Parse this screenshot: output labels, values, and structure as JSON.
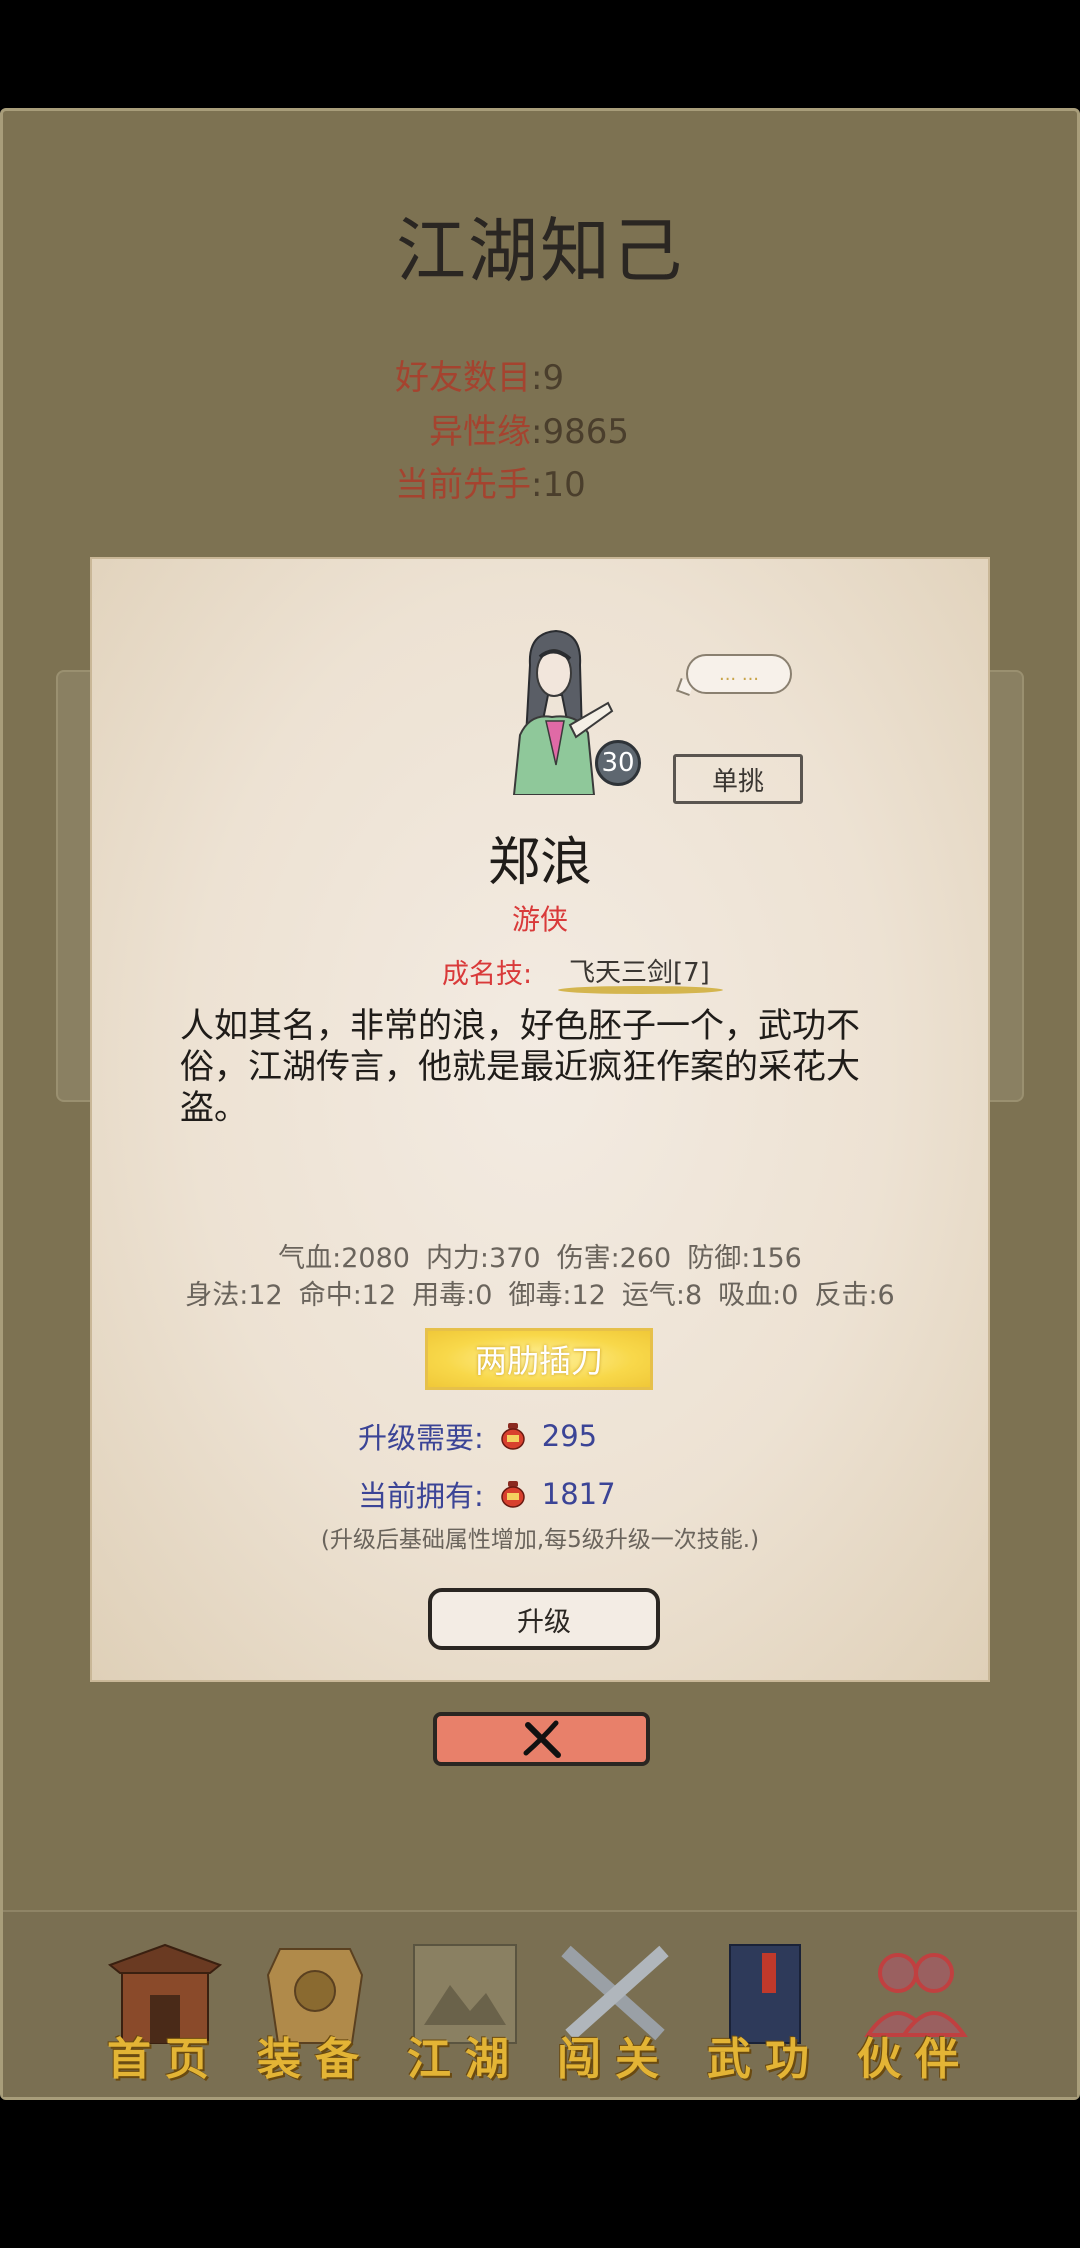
{
  "title": "江湖知己",
  "stats": {
    "friends": {
      "label": "好友数目",
      "value": "9"
    },
    "affinity": {
      "label": "异性缘",
      "value": "9865"
    },
    "initiative": {
      "label": "当前先手",
      "value": "10"
    }
  },
  "character": {
    "level": "30",
    "speech": "... ...",
    "duel_label": "单挑",
    "name": "郑浪",
    "class": "游侠",
    "skill_label": "成名技:",
    "skill_name": "飞天三剑[7]",
    "description": "人如其名，非常的浪，好色胚子一个，武功不俗，江湖传言，他就是最近疯狂作案的采花大盗。",
    "attrs_row1": [
      "气血:2080",
      "内力:370",
      "伤害:260",
      "防御:156"
    ],
    "attrs_row2": [
      "身法:12",
      "命中:12",
      "用毒:0",
      "御毒:12",
      "运气:8",
      "吸血:0",
      "反击:6"
    ],
    "ability_label": "两肋插刀",
    "upgrade_need_label": "升级需要:",
    "upgrade_need_value": "295",
    "owned_label": "当前拥有:",
    "owned_value": "1817",
    "note": "(升级后基础属性增加,每5级升级一次技能.)",
    "upgrade_label": "升级"
  },
  "nav": [
    {
      "label": "首页",
      "icon": "house-icon"
    },
    {
      "label": "装备",
      "icon": "armor-icon"
    },
    {
      "label": "江湖",
      "icon": "scroll-map-icon"
    },
    {
      "label": "闯关",
      "icon": "crossed-swords-icon"
    },
    {
      "label": "武功",
      "icon": "book-icon"
    },
    {
      "label": "伙伴",
      "icon": "partners-icon"
    }
  ],
  "colors": {
    "background": "#7d7252",
    "accent_red": "#d93a3a",
    "gold": "#e3b435",
    "cost_blue": "#3b4496"
  }
}
